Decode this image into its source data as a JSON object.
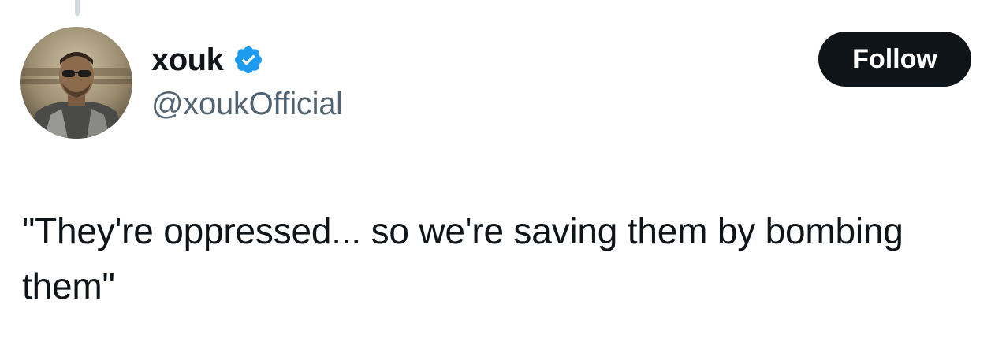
{
  "tweet": {
    "author": {
      "display_name": "xouk",
      "handle": "@xoukOfficial",
      "verified": true,
      "verified_icon": "verified-badge-icon",
      "avatar": "profile-photo"
    },
    "follow_button": {
      "label": "Follow"
    },
    "text": "\"They're oppressed... so we're saving them by bombing them\""
  },
  "colors": {
    "text_primary": "#0f1419",
    "text_secondary": "#536471",
    "verified_blue": "#1d9bf0",
    "button_bg": "#0f1419",
    "button_text": "#ffffff",
    "thread_line": "#cfd9de"
  }
}
